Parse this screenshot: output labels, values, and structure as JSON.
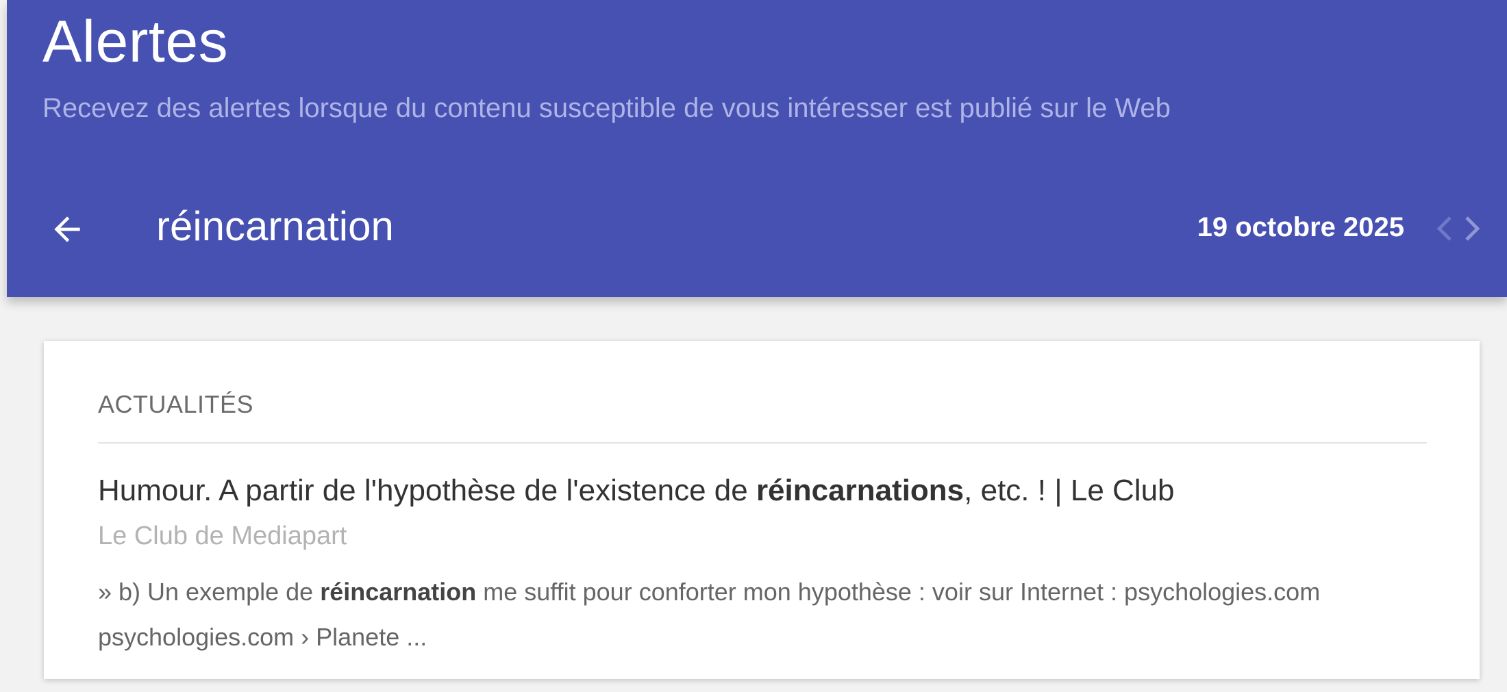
{
  "header": {
    "title": "Alertes",
    "subtitle": "Recevez des alertes lorsque du contenu susceptible de vous intéresser est publié sur le Web",
    "color": "#4651b2"
  },
  "alert": {
    "back_icon": "arrow-left-icon",
    "query": "réincarnation",
    "date": "19 octobre 2025",
    "prev_icon": "chevron-left-icon",
    "next_icon": "chevron-right-icon"
  },
  "results": {
    "section_label": "ACTUALITÉS",
    "items": [
      {
        "title_before": "Humour. A partir de l'hypothèse de l'existence de ",
        "title_highlight": "réincarnations",
        "title_after": ", etc. ! | Le Club",
        "source": "Le Club de Mediapart",
        "snippet_line1_before": "» b) Un exemple de ",
        "snippet_line1_highlight": "réincarnation",
        "snippet_line1_after": " me suffit pour conforter mon hypothèse : voir sur Internet : psychologies.com",
        "snippet_line2": "psychologies.com › Planete ..."
      }
    ]
  }
}
